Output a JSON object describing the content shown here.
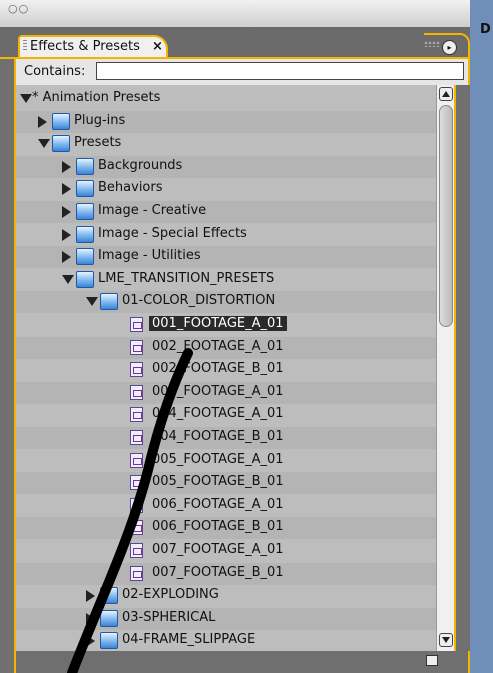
{
  "window": {
    "traffic_lights": "○○"
  },
  "desktop": {
    "letter": "D"
  },
  "panel": {
    "tab_label": "Effects & Presets",
    "tab_close": "×",
    "menu_button": "▸"
  },
  "search": {
    "label": "Contains:",
    "value": ""
  },
  "tree": {
    "rows": [
      {
        "label": "* Animation Presets",
        "type": "root",
        "depth": 0,
        "expanded": true
      },
      {
        "label": "Plug-ins",
        "type": "folder",
        "depth": 1,
        "expanded": false
      },
      {
        "label": "Presets",
        "type": "folder",
        "depth": 1,
        "expanded": true
      },
      {
        "label": "Backgrounds",
        "type": "folder",
        "depth": 2,
        "expanded": false
      },
      {
        "label": "Behaviors",
        "type": "folder",
        "depth": 2,
        "expanded": false
      },
      {
        "label": "Image - Creative",
        "type": "folder",
        "depth": 2,
        "expanded": false
      },
      {
        "label": "Image - Special Effects",
        "type": "folder",
        "depth": 2,
        "expanded": false
      },
      {
        "label": "Image - Utilities",
        "type": "folder",
        "depth": 2,
        "expanded": false
      },
      {
        "label": "LME_TRANSITION_PRESETS",
        "type": "folder",
        "depth": 2,
        "expanded": true
      },
      {
        "label": "01-COLOR_DISTORTION",
        "type": "folder",
        "depth": 3,
        "expanded": true
      },
      {
        "label": "001_FOOTAGE_A_01",
        "type": "file",
        "depth": 4,
        "selected": true
      },
      {
        "label": "002_FOOTAGE_A_01",
        "type": "file",
        "depth": 4
      },
      {
        "label": "002_FOOTAGE_B_01",
        "type": "file",
        "depth": 4
      },
      {
        "label": "003_FOOTAGE_A_01",
        "type": "file",
        "depth": 4
      },
      {
        "label": "004_FOOTAGE_A_01",
        "type": "file",
        "depth": 4
      },
      {
        "label": "004_FOOTAGE_B_01",
        "type": "file",
        "depth": 4
      },
      {
        "label": "005_FOOTAGE_A_01",
        "type": "file",
        "depth": 4
      },
      {
        "label": "005_FOOTAGE_B_01",
        "type": "file",
        "depth": 4
      },
      {
        "label": "006_FOOTAGE_A_01",
        "type": "file",
        "depth": 4
      },
      {
        "label": "006_FOOTAGE_B_01",
        "type": "file",
        "depth": 4
      },
      {
        "label": "007_FOOTAGE_A_01",
        "type": "file",
        "depth": 4
      },
      {
        "label": "007_FOOTAGE_B_01",
        "type": "file",
        "depth": 4
      },
      {
        "label": "02-EXPLODING",
        "type": "folder",
        "depth": 3,
        "expanded": false
      },
      {
        "label": "03-SPHERICAL",
        "type": "folder",
        "depth": 3,
        "expanded": false
      },
      {
        "label": "04-FRAME_SLIPPAGE",
        "type": "folder",
        "depth": 3,
        "expanded": false
      }
    ]
  },
  "colors": {
    "accent": "#f5b400",
    "panel": "#707070",
    "tree_bg": "#bdbdbd",
    "selection": "#2a2a2a"
  }
}
